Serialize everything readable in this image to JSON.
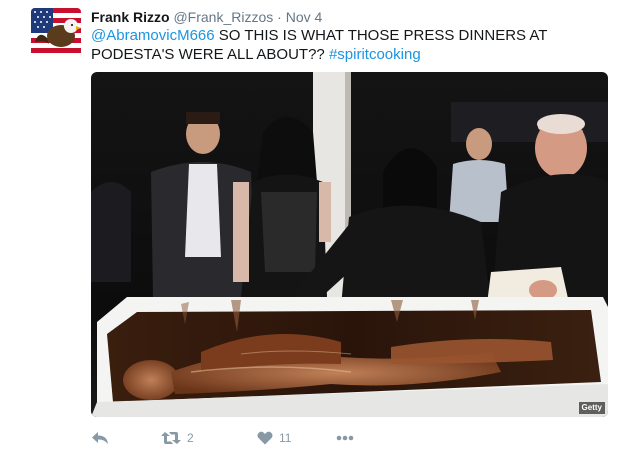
{
  "tweet": {
    "author": {
      "display_name": "Frank Rizzo",
      "handle": "@Frank_Rizzos",
      "separator": "·",
      "time": "Nov 4",
      "avatar_icon": "american-flag-eagle-avatar"
    },
    "text": {
      "mention": "@AbramovicM666",
      "body": " SO THIS IS WHAT THOSE PRESS DINNERS AT PODESTA'S WERE ALL ABOUT?? ",
      "hashtag": "#spiritcooking"
    },
    "media": {
      "watermark": "Getty"
    },
    "actions": {
      "reply_icon": "reply-icon",
      "retweet_icon": "retweet-icon",
      "retweet_count": "2",
      "like_icon": "heart-icon",
      "like_count": "11",
      "more_icon": "more-icon"
    }
  },
  "colors": {
    "link": "#1b95e0",
    "text": "#14171a",
    "muted": "#657786",
    "action": "#8899a6"
  }
}
